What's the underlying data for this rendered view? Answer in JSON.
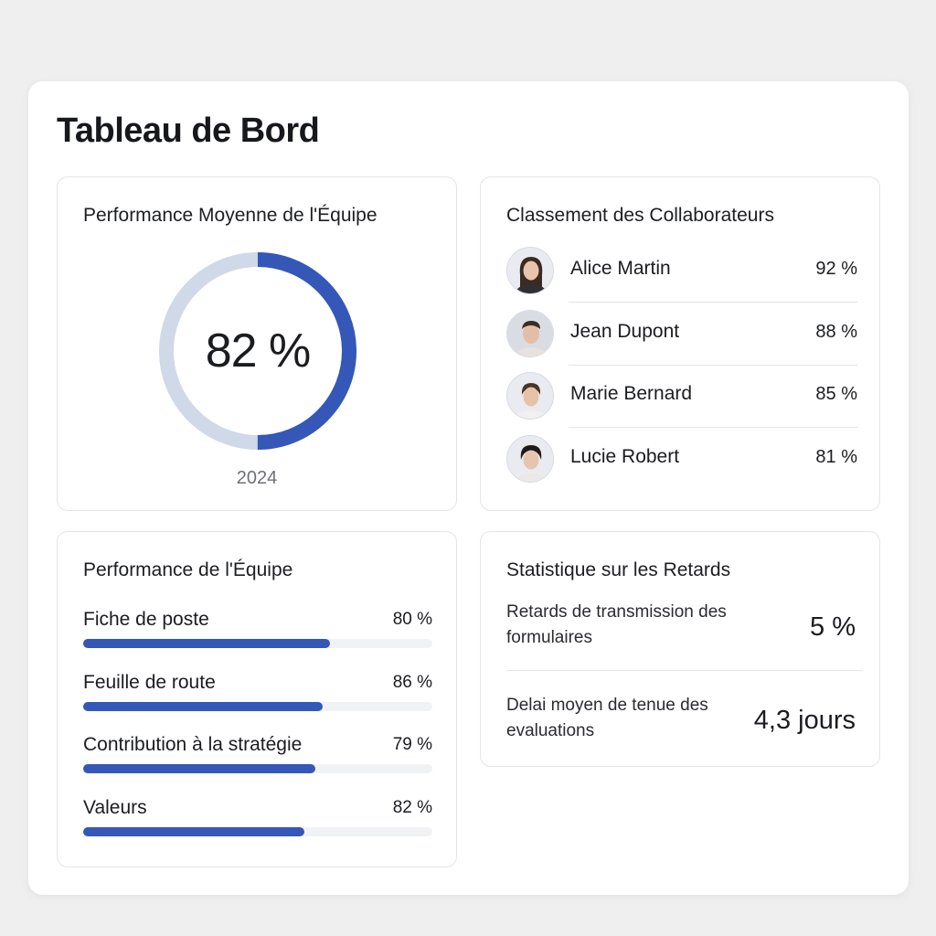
{
  "page": {
    "title": "Tableau de Bord"
  },
  "average_performance": {
    "title": "Performance Moyenne de l'Équipe",
    "value": 82,
    "value_label": "82 %",
    "year": "2024",
    "colors": {
      "fill": "#3457b8",
      "track": "#d0d9e8"
    }
  },
  "ranking": {
    "title": "Classement des Collaborateurs",
    "items": [
      {
        "name": "Alice Martin",
        "pct": "92 %",
        "icon": "avatar-woman-long-hair"
      },
      {
        "name": "Jean Dupont",
        "pct": "88 %",
        "icon": "avatar-man-short-hair"
      },
      {
        "name": "Marie Bernard",
        "pct": "85 %",
        "icon": "avatar-woman-hair-back"
      },
      {
        "name": "Lucie Robert",
        "pct": "81 %",
        "icon": "avatar-person-short-hair"
      }
    ]
  },
  "team_performance": {
    "title": "Performance de l'Équipe",
    "items": [
      {
        "label": "Fiche de poste",
        "value_label": "80 %",
        "value": 80
      },
      {
        "label": "Feuille de route",
        "value_label": "86 %",
        "value": 86
      },
      {
        "label": "Contribution à la stratégie",
        "value_label": "79 %",
        "value": 79
      },
      {
        "label": "Valeurs",
        "value_label": "82 %",
        "value": 82
      }
    ],
    "colors": {
      "bar": "#3457b8",
      "track": "#f1f2f4"
    }
  },
  "delays": {
    "title": "Statistique sur les Retards",
    "items": [
      {
        "description": "Retards de transmission des formulaires",
        "value": "5 %"
      },
      {
        "description": "Delai moyen de tenue des evaluations",
        "value": "4,3 jours"
      }
    ]
  }
}
